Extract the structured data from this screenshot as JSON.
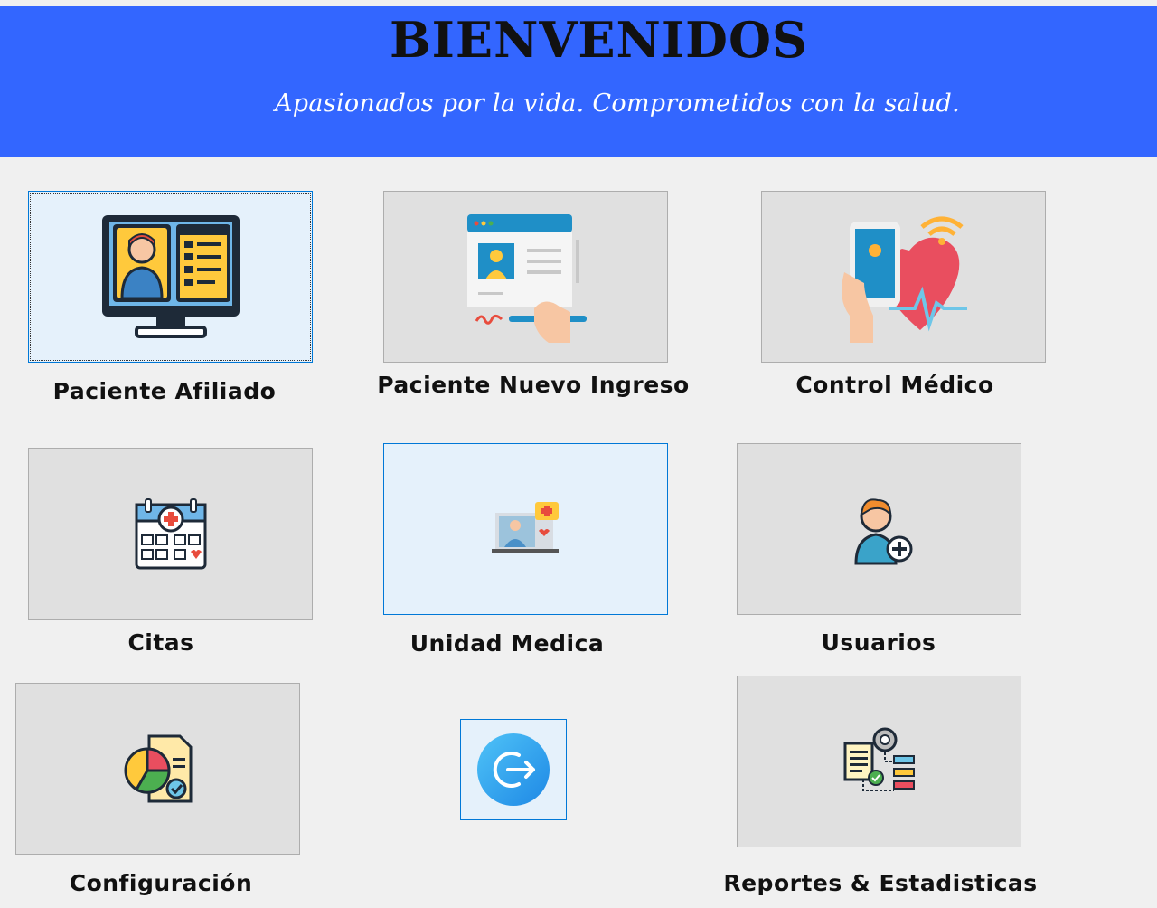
{
  "header": {
    "title": "BIENVENIDOS",
    "subtitle": "Apasionados por la vida. Comprometidos con la salud."
  },
  "colors": {
    "header_bg": "#3366ff",
    "background": "#f0f0f0",
    "tile_bg": "#e0e0e0",
    "tile_focus_bg": "#e5f1fb",
    "focus_border": "#0078d7"
  },
  "tiles": [
    {
      "label": "Paciente Afiliado",
      "icon": "computer-profile-icon"
    },
    {
      "label": "Paciente Nuevo Ingreso",
      "icon": "registration-form-icon"
    },
    {
      "label": "Control  Médico",
      "icon": "health-monitor-icon"
    },
    {
      "label": "Citas",
      "icon": "medical-calendar-icon"
    },
    {
      "label": "Unidad Medica",
      "icon": "telemedicine-icon"
    },
    {
      "label": "Usuarios",
      "icon": "add-user-icon"
    },
    {
      "label": "Configuración",
      "icon": "chart-report-icon"
    },
    {
      "label": "",
      "icon": "logout-icon"
    },
    {
      "label": "Reportes & Estadisticas",
      "icon": "workflow-gear-icon"
    }
  ]
}
